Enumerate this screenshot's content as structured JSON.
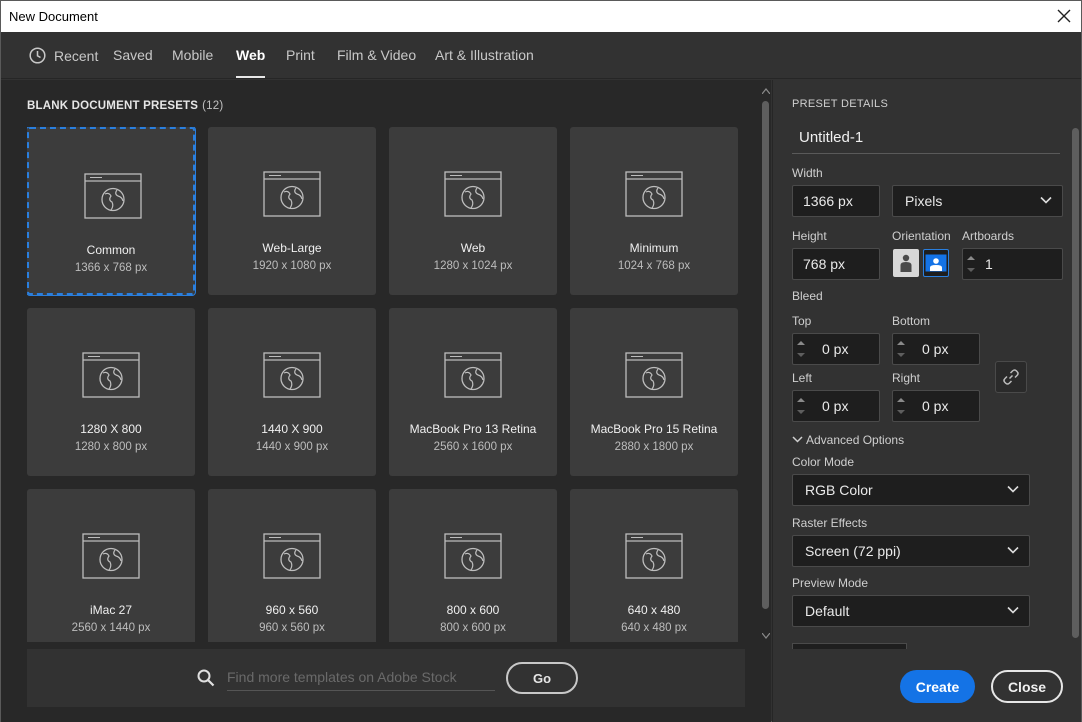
{
  "window": {
    "title": "New Document"
  },
  "tabs": [
    {
      "label": "Recent",
      "active": false
    },
    {
      "label": "Saved",
      "active": false
    },
    {
      "label": "Mobile",
      "active": false
    },
    {
      "label": "Web",
      "active": true
    },
    {
      "label": "Print",
      "active": false
    },
    {
      "label": "Film & Video",
      "active": false
    },
    {
      "label": "Art & Illustration",
      "active": false
    }
  ],
  "presets": {
    "title": "BLANK DOCUMENT PRESETS",
    "count": "(12)",
    "items": [
      {
        "name": "Common",
        "size": "1366 x 768 px",
        "selected": true
      },
      {
        "name": "Web-Large",
        "size": "1920 x 1080 px"
      },
      {
        "name": "Web",
        "size": "1280 x 1024 px"
      },
      {
        "name": "Minimum",
        "size": "1024 x 768 px"
      },
      {
        "name": "1280 X 800",
        "size": "1280 x 800 px"
      },
      {
        "name": "1440 X 900",
        "size": "1440 x 900 px"
      },
      {
        "name": "MacBook Pro 13 Retina",
        "size": "2560 x 1600 px"
      },
      {
        "name": "MacBook Pro 15 Retina",
        "size": "2880 x 1800 px"
      },
      {
        "name": "iMac 27",
        "size": "2560 x 1440 px"
      },
      {
        "name": "960 x 560",
        "size": "960 x 560 px"
      },
      {
        "name": "800 x 600",
        "size": "800 x 600 px"
      },
      {
        "name": "640 x 480",
        "size": "640 x 480 px"
      }
    ]
  },
  "search": {
    "placeholder": "Find more templates on Adobe Stock",
    "go_label": "Go"
  },
  "details": {
    "header": "PRESET DETAILS",
    "doc_name": "Untitled-1",
    "width_label": "Width",
    "width_value": "1366 px",
    "units": "Pixels",
    "height_label": "Height",
    "height_value": "768 px",
    "orientation_label": "Orientation",
    "artboards_label": "Artboards",
    "artboards_value": "1",
    "bleed_label": "Bleed",
    "top_label": "Top",
    "top_value": "0 px",
    "bottom_label": "Bottom",
    "bottom_value": "0 px",
    "left_label": "Left",
    "left_value": "0 px",
    "right_label": "Right",
    "right_value": "0 px",
    "advanced_label": "Advanced Options",
    "color_mode_label": "Color Mode",
    "color_mode_value": "RGB Color",
    "raster_label": "Raster Effects",
    "raster_value": "Screen (72 ppi)",
    "preview_label": "Preview Mode",
    "preview_value": "Default",
    "create_label": "Create",
    "close_label": "Close"
  },
  "colors": {
    "accent": "#1473e6",
    "selection": "#2a7fde",
    "panel": "#323232",
    "grid_bg": "#282828",
    "card": "#3c3c3c"
  }
}
